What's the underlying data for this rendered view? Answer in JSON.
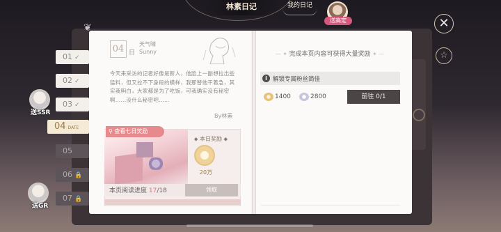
{
  "header": {
    "title": "林素日记",
    "my_diary": "我的日记",
    "avatar_tag": "送高定"
  },
  "tabs": [
    {
      "label": "01",
      "state": "done"
    },
    {
      "label": "02",
      "state": "done"
    },
    {
      "label": "03",
      "state": "done"
    },
    {
      "label": "04",
      "state": "active",
      "sub": "DATE"
    },
    {
      "label": "05",
      "state": "open"
    },
    {
      "label": "06",
      "state": "locked"
    },
    {
      "label": "07",
      "state": "locked"
    }
  ],
  "side_characters": [
    {
      "tag": "送SSR"
    },
    {
      "tag": "送GR"
    }
  ],
  "left_page": {
    "date": "04",
    "day_suffix": "日",
    "weather_label": "天气晴",
    "weather_en": "Sunny",
    "diary_text": "今天来采访的记者好像是新人，他脸上一副想拉出些猛料，但又拉不下身段的模样，我那替他干着急，其实我明白，大家都是为了吃饭，可我确实没有秘密啊……没什么秘密吧……",
    "author": "By林素",
    "view_rewards_button": "查看七日奖励",
    "today_reward_label": "本日奖励",
    "reward_value": "20万",
    "progress_label": "本页阅读进度",
    "progress_current": "17",
    "progress_sep": "/",
    "progress_total": "18",
    "claim_button": "领取"
  },
  "right_page": {
    "title": "完成本页内容可获得大量奖励",
    "unlock_text": "解锁专属粉丝简佳",
    "coin_value": "1400",
    "gem_value": "2800",
    "go_button": "前往 0/1"
  }
}
